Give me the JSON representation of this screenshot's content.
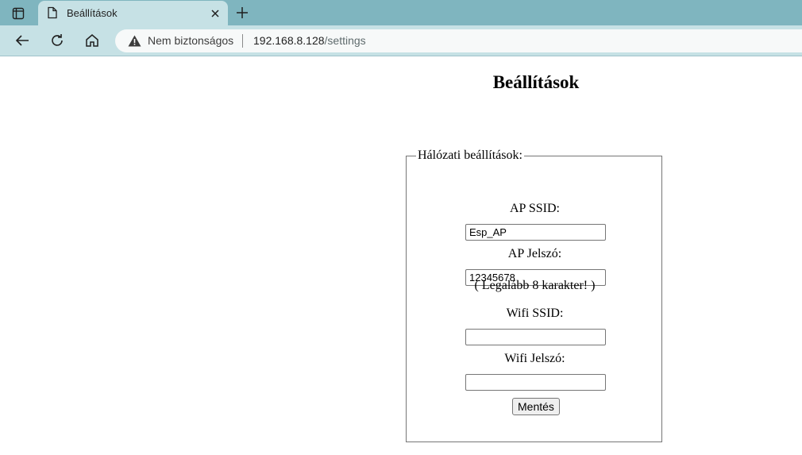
{
  "browser": {
    "tab_title": "Beállítások",
    "security_label": "Nem biztonságos",
    "url_host": "192.168.8.128",
    "url_path": "/settings"
  },
  "page": {
    "heading": "Beállítások",
    "fieldset_legend": "Hálózati beállítások:",
    "ap_ssid_label": "AP SSID:",
    "ap_ssid_value": "Esp_AP",
    "ap_password_label": "AP Jelszó:",
    "ap_password_value": "12345678",
    "ap_password_hint": "( Legalább 8 karakter! )",
    "wifi_ssid_label": "Wifi SSID:",
    "wifi_ssid_value": "",
    "wifi_password_label": "Wifi Jelszó:",
    "wifi_password_value": "",
    "save_label": "Mentés"
  }
}
